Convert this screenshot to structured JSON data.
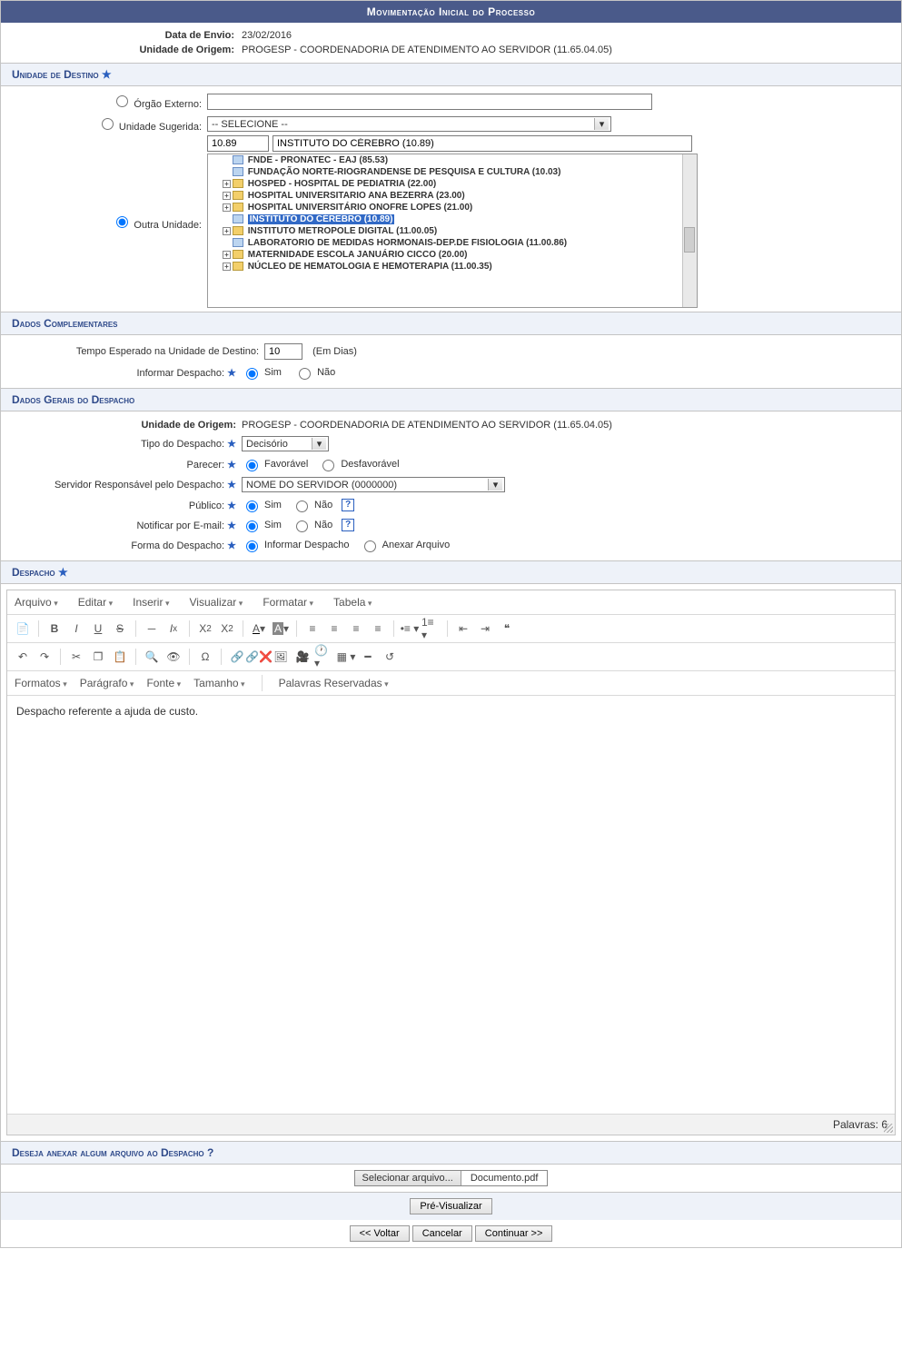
{
  "title": "Movimentação Inicial do Processo",
  "header": {
    "data_envio_label": "Data de Envio:",
    "data_envio_value": "23/02/2016",
    "unidade_origem_label": "Unidade de Origem:",
    "unidade_origem_value": "PROGESP - COORDENADORIA DE ATENDIMENTO AO SERVIDOR (11.65.04.05)"
  },
  "sections": {
    "unidade_destino": "Unidade de Destino",
    "dados_complementares": "Dados Complementares",
    "dados_gerais": "Dados Gerais do Despacho",
    "despacho": "Despacho",
    "anexar": "Deseja anexar algum arquivo ao Despacho ?"
  },
  "destino": {
    "orgao_externo_label": "Órgão Externo:",
    "orgao_externo_value": "",
    "unidade_sugerida_label": "Unidade Sugerida:",
    "unidade_sugerida_value": "-- SELECIONE --",
    "outra_unidade_label": "Outra Unidade:",
    "code_input": "10.89",
    "name_input": "INSTITUTO DO CÉREBRO (10.89)",
    "tree": [
      {
        "type": "doc",
        "label": "FNDE - PRONATEC - EAJ (85.53)"
      },
      {
        "type": "doc",
        "label": "FUNDAÇÃO NORTE-RIOGRANDENSE DE PESQUISA E CULTURA (10.03)"
      },
      {
        "type": "folder",
        "expand": true,
        "label": "HOSPED - HOSPITAL DE PEDIATRIA (22.00)"
      },
      {
        "type": "folder",
        "expand": true,
        "label": "HOSPITAL UNIVERSITARIO ANA BEZERRA (23.00)"
      },
      {
        "type": "folder",
        "expand": true,
        "label": "HOSPITAL UNIVERSITÁRIO ONOFRE LOPES (21.00)"
      },
      {
        "type": "doc",
        "selected": true,
        "label": "INSTITUTO DO CÉREBRO (10.89)"
      },
      {
        "type": "folder",
        "expand": true,
        "label": "INSTITUTO METROPOLE DIGITAL (11.00.05)"
      },
      {
        "type": "doc",
        "label": "LABORATORIO DE MEDIDAS HORMONAIS-DEP.DE FISIOLOGIA (11.00.86)"
      },
      {
        "type": "folder",
        "expand": true,
        "label": "MATERNIDADE ESCOLA JANUÁRIO CICCO (20.00)"
      },
      {
        "type": "folder",
        "expand": true,
        "label": "NÚCLEO DE HEMATOLOGIA E HEMOTERAPIA (11.00.35)"
      }
    ]
  },
  "complementares": {
    "tempo_label": "Tempo Esperado na Unidade de Destino:",
    "tempo_value": "10",
    "tempo_unit": "(Em Dias)",
    "informar_label": "Informar Despacho:",
    "sim": "Sim",
    "nao": "Não"
  },
  "gerais": {
    "unidade_origem_label": "Unidade de Origem:",
    "unidade_origem_value": "PROGESP - COORDENADORIA DE ATENDIMENTO AO SERVIDOR (11.65.04.05)",
    "tipo_label": "Tipo do Despacho:",
    "tipo_value": "Decisório",
    "parecer_label": "Parecer:",
    "favoravel": "Favorável",
    "desfavoravel": "Desfavorável",
    "servidor_label": "Servidor Responsável pelo Despacho:",
    "servidor_value": "NOME DO SERVIDOR (0000000)",
    "publico_label": "Público:",
    "notificar_label": "Notificar por E-mail:",
    "forma_label": "Forma do Despacho:",
    "informar_despacho": "Informar Despacho",
    "anexar_arquivo": "Anexar Arquivo",
    "sim": "Sim",
    "nao": "Não"
  },
  "editor": {
    "menus": [
      "Arquivo",
      "Editar",
      "Inserir",
      "Visualizar",
      "Formatar",
      "Tabela"
    ],
    "formats": [
      "Formatos",
      "Parágrafo",
      "Fonte",
      "Tamanho"
    ],
    "reserved": "Palavras Reservadas",
    "content": "Despacho referente a ajuda de custo.",
    "wordcount_label": "Palavras:",
    "wordcount_value": "6"
  },
  "file": {
    "button": "Selecionar arquivo...",
    "name": "Documento.pdf"
  },
  "actions": {
    "preview": "Pré-Visualizar",
    "voltar": "<< Voltar",
    "cancelar": "Cancelar",
    "continuar": "Continuar >>"
  }
}
